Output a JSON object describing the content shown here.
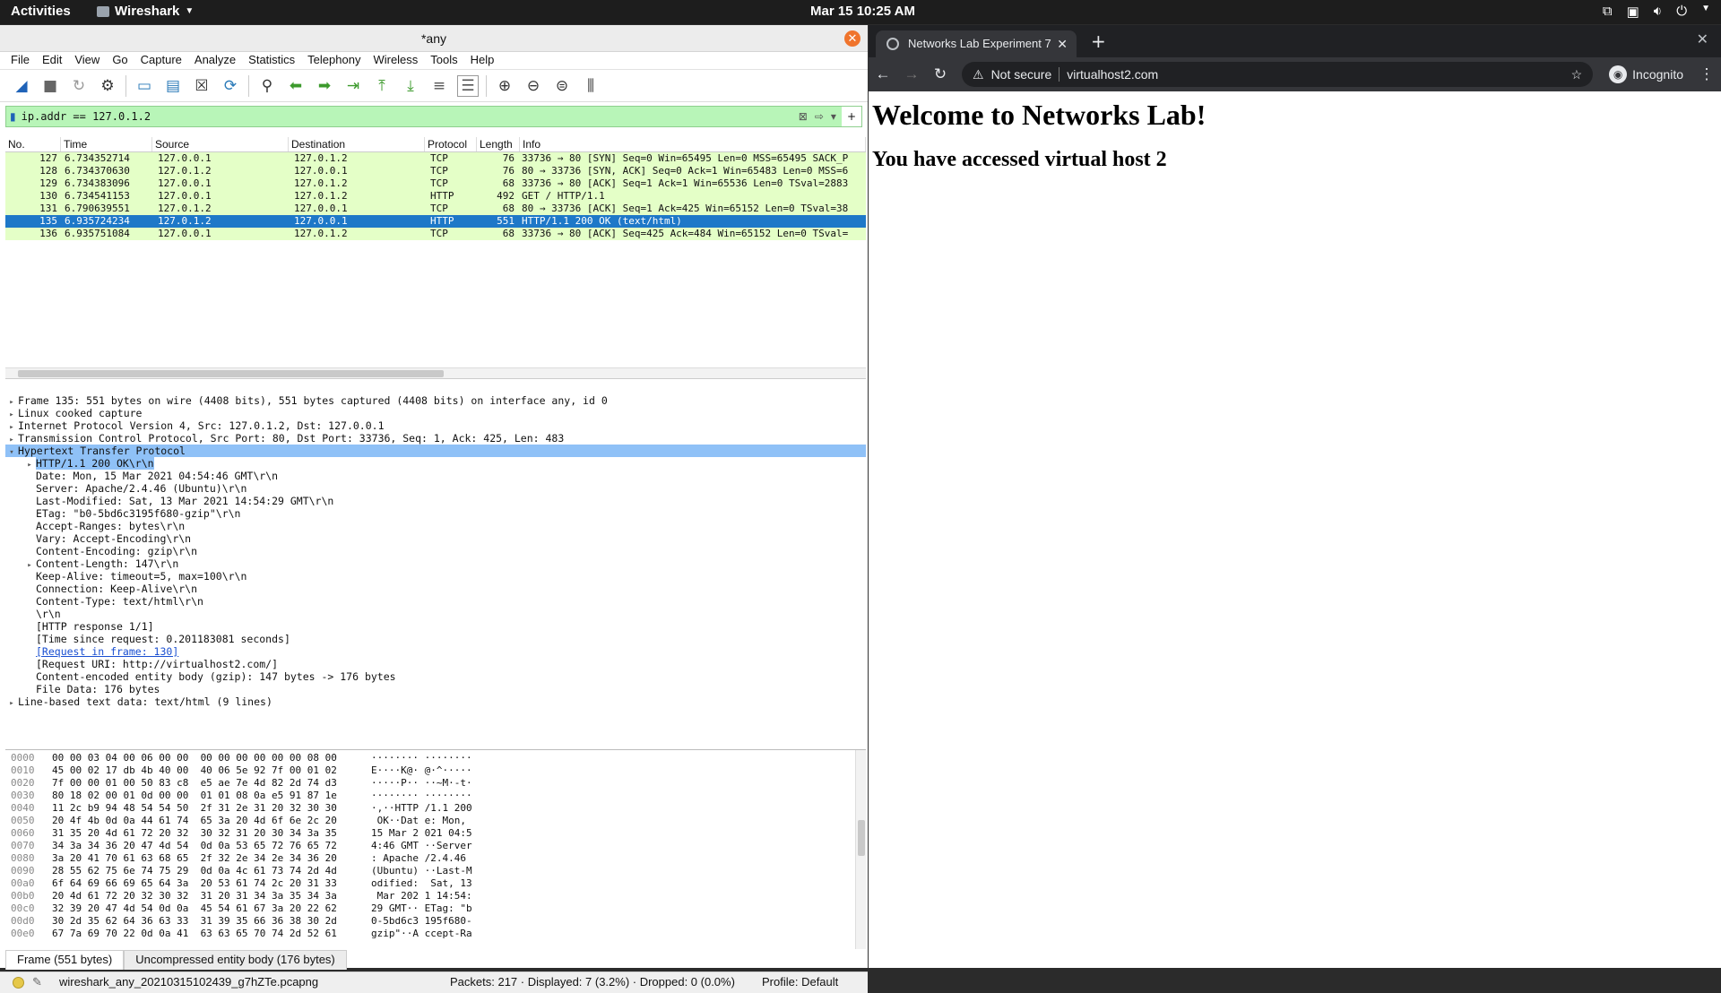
{
  "topbar": {
    "activities": "Activities",
    "app": "Wireshark",
    "clock": "Mar 15  10:25 AM"
  },
  "wireshark": {
    "title": "*any",
    "menu": [
      "File",
      "Edit",
      "View",
      "Go",
      "Capture",
      "Analyze",
      "Statistics",
      "Telephony",
      "Wireless",
      "Tools",
      "Help"
    ],
    "filter": "ip.addr == 127.0.1.2",
    "columns": [
      "No.",
      "Time",
      "Source",
      "Destination",
      "Protocol",
      "Length",
      "Info"
    ],
    "packets": [
      {
        "no": "127",
        "time": "6.734352714",
        "src": "127.0.0.1",
        "dst": "127.0.1.2",
        "proto": "TCP",
        "len": "76",
        "info": "33736 → 80 [SYN] Seq=0 Win=65495 Len=0 MSS=65495 SACK_P"
      },
      {
        "no": "128",
        "time": "6.734370630",
        "src": "127.0.1.2",
        "dst": "127.0.0.1",
        "proto": "TCP",
        "len": "76",
        "info": "80 → 33736 [SYN, ACK] Seq=0 Ack=1 Win=65483 Len=0 MSS=6"
      },
      {
        "no": "129",
        "time": "6.734383096",
        "src": "127.0.0.1",
        "dst": "127.0.1.2",
        "proto": "TCP",
        "len": "68",
        "info": "33736 → 80 [ACK] Seq=1 Ack=1 Win=65536 Len=0 TSval=2883"
      },
      {
        "no": "130",
        "time": "6.734541153",
        "src": "127.0.0.1",
        "dst": "127.0.1.2",
        "proto": "HTTP",
        "len": "492",
        "info": "GET / HTTP/1.1"
      },
      {
        "no": "131",
        "time": "6.790639551",
        "src": "127.0.1.2",
        "dst": "127.0.0.1",
        "proto": "TCP",
        "len": "68",
        "info": "80 → 33736 [ACK] Seq=1 Ack=425 Win=65152 Len=0 TSval=38"
      },
      {
        "no": "135",
        "time": "6.935724234",
        "src": "127.0.1.2",
        "dst": "127.0.0.1",
        "proto": "HTTP",
        "len": "551",
        "info": "HTTP/1.1 200 OK  (text/html)"
      },
      {
        "no": "136",
        "time": "6.935751084",
        "src": "127.0.0.1",
        "dst": "127.0.1.2",
        "proto": "TCP",
        "len": "68",
        "info": "33736 → 80 [ACK] Seq=425 Ack=484 Win=65152 Len=0 TSval="
      }
    ],
    "details": [
      {
        "t": "Frame 135: 551 bytes on wire (4408 bits), 551 bytes captured (4408 bits) on interface any, id 0",
        "lvl": 1,
        "tw": "▸"
      },
      {
        "t": "Linux cooked capture",
        "lvl": 1,
        "tw": "▸"
      },
      {
        "t": "Internet Protocol Version 4, Src: 127.0.1.2, Dst: 127.0.0.1",
        "lvl": 1,
        "tw": "▸"
      },
      {
        "t": "Transmission Control Protocol, Src Port: 80, Dst Port: 33736, Seq: 1, Ack: 425, Len: 483",
        "lvl": 1,
        "tw": "▸"
      },
      {
        "t": "Hypertext Transfer Protocol",
        "lvl": 1,
        "tw": "▾"
      },
      {
        "t": "HTTP/1.1 200 OK\\r\\n",
        "lvl": 2,
        "tw": "▸"
      },
      {
        "t": "Date: Mon, 15 Mar 2021 04:54:46 GMT\\r\\n",
        "lvl": 2,
        "tw": ""
      },
      {
        "t": "Server: Apache/2.4.46 (Ubuntu)\\r\\n",
        "lvl": 2,
        "tw": ""
      },
      {
        "t": "Last-Modified: Sat, 13 Mar 2021 14:54:29 GMT\\r\\n",
        "lvl": 2,
        "tw": ""
      },
      {
        "t": "ETag: \"b0-5bd6c3195f680-gzip\"\\r\\n",
        "lvl": 2,
        "tw": ""
      },
      {
        "t": "Accept-Ranges: bytes\\r\\n",
        "lvl": 2,
        "tw": ""
      },
      {
        "t": "Vary: Accept-Encoding\\r\\n",
        "lvl": 2,
        "tw": ""
      },
      {
        "t": "Content-Encoding: gzip\\r\\n",
        "lvl": 2,
        "tw": ""
      },
      {
        "t": "Content-Length: 147\\r\\n",
        "lvl": 2,
        "tw": "▸"
      },
      {
        "t": "Keep-Alive: timeout=5, max=100\\r\\n",
        "lvl": 2,
        "tw": ""
      },
      {
        "t": "Connection: Keep-Alive\\r\\n",
        "lvl": 2,
        "tw": ""
      },
      {
        "t": "Content-Type: text/html\\r\\n",
        "lvl": 2,
        "tw": ""
      },
      {
        "t": "\\r\\n",
        "lvl": 2,
        "tw": ""
      },
      {
        "t": "[HTTP response 1/1]",
        "lvl": 2,
        "tw": ""
      },
      {
        "t": "[Time since request: 0.201183081 seconds]",
        "lvl": 2,
        "tw": ""
      },
      {
        "t": "[Request in frame: 130]",
        "lvl": 2,
        "tw": ""
      },
      {
        "t": "[Request URI: http://virtualhost2.com/]",
        "lvl": 2,
        "tw": ""
      },
      {
        "t": "Content-encoded entity body (gzip): 147 bytes -> 176 bytes",
        "lvl": 2,
        "tw": ""
      },
      {
        "t": "File Data: 176 bytes",
        "lvl": 2,
        "tw": ""
      },
      {
        "t": "Line-based text data: text/html (9 lines)",
        "lvl": 1,
        "tw": "▸"
      }
    ],
    "hex": [
      {
        "off": "0000",
        "b": "00 00 03 04 00 06 00 00  00 00 00 00 00 00 08 00",
        "a": "········ ········"
      },
      {
        "off": "0010",
        "b": "45 00 02 17 db 4b 40 00  40 06 5e 92 7f 00 01 02",
        "a": "E····K@· @·^·····"
      },
      {
        "off": "0020",
        "b": "7f 00 00 01 00 50 83 c8  e5 ae 7e 4d 82 2d 74 d3",
        "a": "·····P·· ··~M·-t·"
      },
      {
        "off": "0030",
        "b": "80 18 02 00 01 0d 00 00  01 01 08 0a e5 91 87 1e",
        "a": "········ ········"
      },
      {
        "off": "0040",
        "b": "11 2c b9 94 48 54 54 50  2f 31 2e 31 20 32 30 30",
        "a": "·,··HTTP /1.1 200"
      },
      {
        "off": "0050",
        "b": "20 4f 4b 0d 0a 44 61 74  65 3a 20 4d 6f 6e 2c 20",
        "a": " OK··Dat e: Mon, "
      },
      {
        "off": "0060",
        "b": "31 35 20 4d 61 72 20 32  30 32 31 20 30 34 3a 35",
        "a": "15 Mar 2 021 04:5"
      },
      {
        "off": "0070",
        "b": "34 3a 34 36 20 47 4d 54  0d 0a 53 65 72 76 65 72",
        "a": "4:46 GMT ··Server"
      },
      {
        "off": "0080",
        "b": "3a 20 41 70 61 63 68 65  2f 32 2e 34 2e 34 36 20",
        "a": ": Apache /2.4.46 "
      },
      {
        "off": "0090",
        "b": "28 55 62 75 6e 74 75 29  0d 0a 4c 61 73 74 2d 4d",
        "a": "(Ubuntu) ··Last-M"
      },
      {
        "off": "00a0",
        "b": "6f 64 69 66 69 65 64 3a  20 53 61 74 2c 20 31 33",
        "a": "odified:  Sat, 13"
      },
      {
        "off": "00b0",
        "b": "20 4d 61 72 20 32 30 32  31 20 31 34 3a 35 34 3a",
        "a": " Mar 202 1 14:54:"
      },
      {
        "off": "00c0",
        "b": "32 39 20 47 4d 54 0d 0a  45 54 61 67 3a 20 22 62",
        "a": "29 GMT·· ETag: \"b"
      },
      {
        "off": "00d0",
        "b": "30 2d 35 62 64 36 63 33  31 39 35 66 36 38 30 2d",
        "a": "0-5bd6c3 195f680-"
      },
      {
        "off": "00e0",
        "b": "67 7a 69 70 22 0d 0a 41  63 63 65 70 74 2d 52 61",
        "a": "gzip\"··A ccept-Ra"
      }
    ],
    "bottom_tabs": [
      "Frame (551 bytes)",
      "Uncompressed entity body (176 bytes)"
    ],
    "status": {
      "file": "wireshark_any_20210315102439_g7hZTe.pcapng",
      "packets": "Packets: 217 · Displayed: 7 (3.2%) · Dropped: 0 (0.0%)",
      "profile": "Profile: Default"
    }
  },
  "browser": {
    "tab_title": "Networks Lab Experiment 7",
    "not_secure": "Not secure",
    "url": "virtualhost2.com",
    "incognito": "Incognito",
    "heading": "Welcome to Networks Lab!",
    "subheading": "You have accessed virtual host 2"
  },
  "colors": {
    "filter_bg": "#b8f5b8",
    "row_bg": "#e4ffc7",
    "selected_row": "#1e78c8",
    "detail_highlight": "#8fc1f7"
  }
}
